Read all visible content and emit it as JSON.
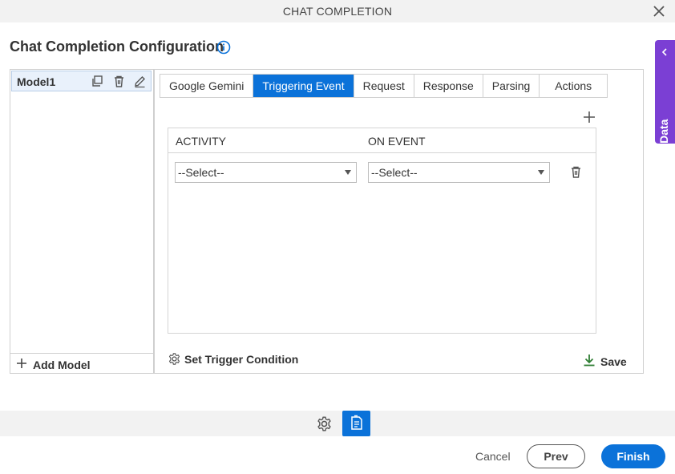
{
  "window": {
    "title": "CHAT COMPLETION",
    "close_icon": "close-icon"
  },
  "page": {
    "heading": "Chat Completion Configuration",
    "info_icon": "info-icon"
  },
  "app_data_tab": {
    "label": "App Data",
    "icon": "chevron-left-icon",
    "color": "#7b3fd4"
  },
  "models": {
    "items": [
      {
        "name": "Model1"
      }
    ],
    "add_label": "Add Model"
  },
  "tabs": [
    {
      "label": "Google Gemini",
      "active": false
    },
    {
      "label": "Triggering Event",
      "active": true
    },
    {
      "label": "Request",
      "active": false
    },
    {
      "label": "Response",
      "active": false
    },
    {
      "label": "Parsing",
      "active": false
    },
    {
      "label": "Actions",
      "active": false
    }
  ],
  "trigger_table": {
    "columns": [
      "ACTIVITY",
      "ON EVENT"
    ],
    "rows": [
      {
        "activity": "--Select--",
        "on_event": "--Select--"
      }
    ]
  },
  "footer_actions": {
    "set_trigger_condition": "Set Trigger Condition",
    "save": "Save"
  },
  "buttons": {
    "cancel": "Cancel",
    "prev": "Prev",
    "finish": "Finish"
  },
  "colors": {
    "accent": "#0b72d9",
    "save_icon": "#2e7d32"
  }
}
